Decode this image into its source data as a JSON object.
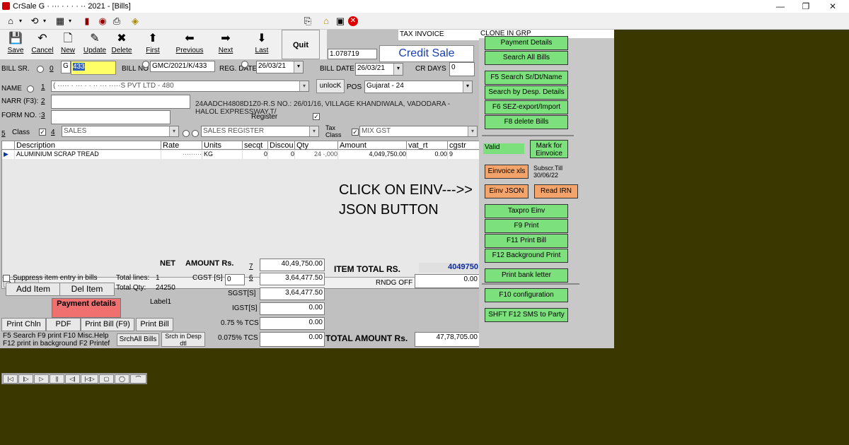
{
  "window": {
    "title": "CrSale G  ·  ··· ·  ·  · ·  ··  2021   - [Bills]",
    "controls": [
      "—",
      "❐",
      "✕"
    ]
  },
  "toolbar_icons": [
    "home-icon",
    "dropdown-icon",
    "nav-icon",
    "dropdown-icon",
    "chart-icon",
    "dropdown-icon",
    "book-icon",
    "cup-icon",
    "printer-icon",
    "money-icon",
    "door-icon",
    "house-icon",
    "save-icon",
    "close-icon"
  ],
  "nav": [
    {
      "label": "Save",
      "icon": "💾"
    },
    {
      "label": "Cancel",
      "icon": "↶"
    },
    {
      "label": "New",
      "icon": "🗋"
    },
    {
      "label": "Update",
      "icon": "✎"
    },
    {
      "label": "Delete",
      "icon": "✖"
    },
    {
      "label": "First",
      "icon": "⬆"
    },
    {
      "label": "Previous",
      "icon": "⬅"
    },
    {
      "label": "Next",
      "icon": "➡"
    },
    {
      "label": "Last",
      "icon": "⬇"
    }
  ],
  "quit_label": "Quit",
  "header": {
    "tax_invoice": "TAX INVOICE",
    "clone": "CLONE IN GRP",
    "rate_field": "1.078719",
    "sale_type": "Credit Sale"
  },
  "bill": {
    "sr_label": "BILL SR.",
    "sr_radio": "0",
    "sr_prefix": "G",
    "sr_no": "433",
    "no_label": "BILL NO",
    "no_value": "GMC/2021/K/433",
    "reg_date_label": "REG. DATE",
    "reg_date": "26/03/21",
    "bill_date_label": "BILL DATE",
    "bill_date": "26/03/21",
    "cr_days_label": "CR DAYS",
    "cr_days": "0"
  },
  "party": {
    "name_label": "NAME",
    "name_key": "1",
    "name_value": "( ·····  ·  ··· ·  ·  ·· ··· ·····S PVT LTD - 480",
    "unlock_label": "unlocK",
    "pos_label": "POS",
    "pos_value": "Gujarat - 24",
    "narr_label": "NARR (F3):",
    "narr_key": "2",
    "form_label": "FORM NO. :",
    "form_key": "3",
    "address": "24AADCH4808D1Z0-R.S NO.: 26/01/16, VILLAGE KHANDIWALA, VADODARA - HALOL EXPRESSWAY,T/",
    "register_label": "Register",
    "class_num": "5",
    "class_label": "Class",
    "class_key": "4",
    "class_value": "SALES",
    "register_value": "SALES REGISTER",
    "tax_class_label": "Tax Class",
    "tax_class_value": "MIX GST"
  },
  "grid": {
    "headers": [
      "Description",
      "Rate",
      "Units",
      "secqt",
      "Discou",
      "Qty",
      "Amount",
      "vat_rt",
      "cgstr"
    ],
    "row": [
      "ALUMINIUM SCRAP TREAD",
      "·········",
      "KG",
      "0",
      "0",
      "24 ·,000",
      "4,049,750.00",
      "0.00",
      "9"
    ]
  },
  "annotation": [
    "CLICK ON EINV--->>",
    "JSON BUTTON"
  ],
  "totals": {
    "net_label": "NET",
    "amount_label": "AMOUNT Rs.",
    "net_key": "7",
    "net_amount": "40,49,750.00",
    "cgst_label": "CGST [S]",
    "cgst_rate": "0",
    "cgst_key": "6",
    "cgst": "3,64,477.50",
    "sgst_label": "SGST[S]",
    "sgst": "3,64,477.50",
    "igst_label": "IGST[S]",
    "igst": "0.00",
    "tcs1_label": "0.75 % TCS",
    "tcs1": "0.00",
    "tcs2_label": "0.075% TCS",
    "tcs2": "0.00",
    "item_total_label": "ITEM  TOTAL RS.",
    "item_total": "4049750",
    "rndg_label": "RNDG OFF",
    "rndg": "0.00",
    "total_label": "TOTAL AMOUNT Rs.",
    "total": "47,78,705.00"
  },
  "bottom": {
    "suppress_label": "Suppress item entry in bills",
    "total_lines_label": "Total lines:",
    "total_lines": "1",
    "total_qty_label": "Total Qty:",
    "total_qty": "24250",
    "label1": "Label1",
    "add_item": "Add Item",
    "del_item": "Del Item",
    "payment_details": "Payment details",
    "print_chln": "Print  Chln",
    "pdf": "PDF",
    "print_bill_f9": "Print  Bill  (F9)",
    "print_bill": "Print  Bill",
    "help1": "F5 Search    F9 print   F10 Misc.Help",
    "help2": "F12 print in background    F2 Printef",
    "srch_all": "SrchAll Bills",
    "srch_desp": "Srch in Desp dtl"
  },
  "rpanel": {
    "payment_details": "Payment Details",
    "search_all": "Search All Bills",
    "f5": "F5  Search Sr/Dt/Name",
    "desp": "Search by Desp. Details",
    "f6": "F6 SEZ-export/Import",
    "f8": "F8 delete Bills",
    "valid": "Valid",
    "mark_einv": "Mark for Einvoice",
    "einv_xls": "Einvoice xls",
    "subscr": "Subscr.Till 30/06/22",
    "einv_json": "Einv JSON",
    "read_irn": "Read IRN",
    "taxpro": "Taxpro  Einv",
    "f9": "F9   Print",
    "f11": "F11  Print Bill",
    "f12": "F12 Background Print",
    "bank": "Print bank letter",
    "f10": "F10 configuration",
    "sms": "SHFT F12   SMS to Party"
  },
  "nav_strip": [
    "|◁",
    "|▷",
    "▷",
    "||",
    "◁|",
    "|◁▷",
    "▢",
    "◯",
    "⌒"
  ]
}
